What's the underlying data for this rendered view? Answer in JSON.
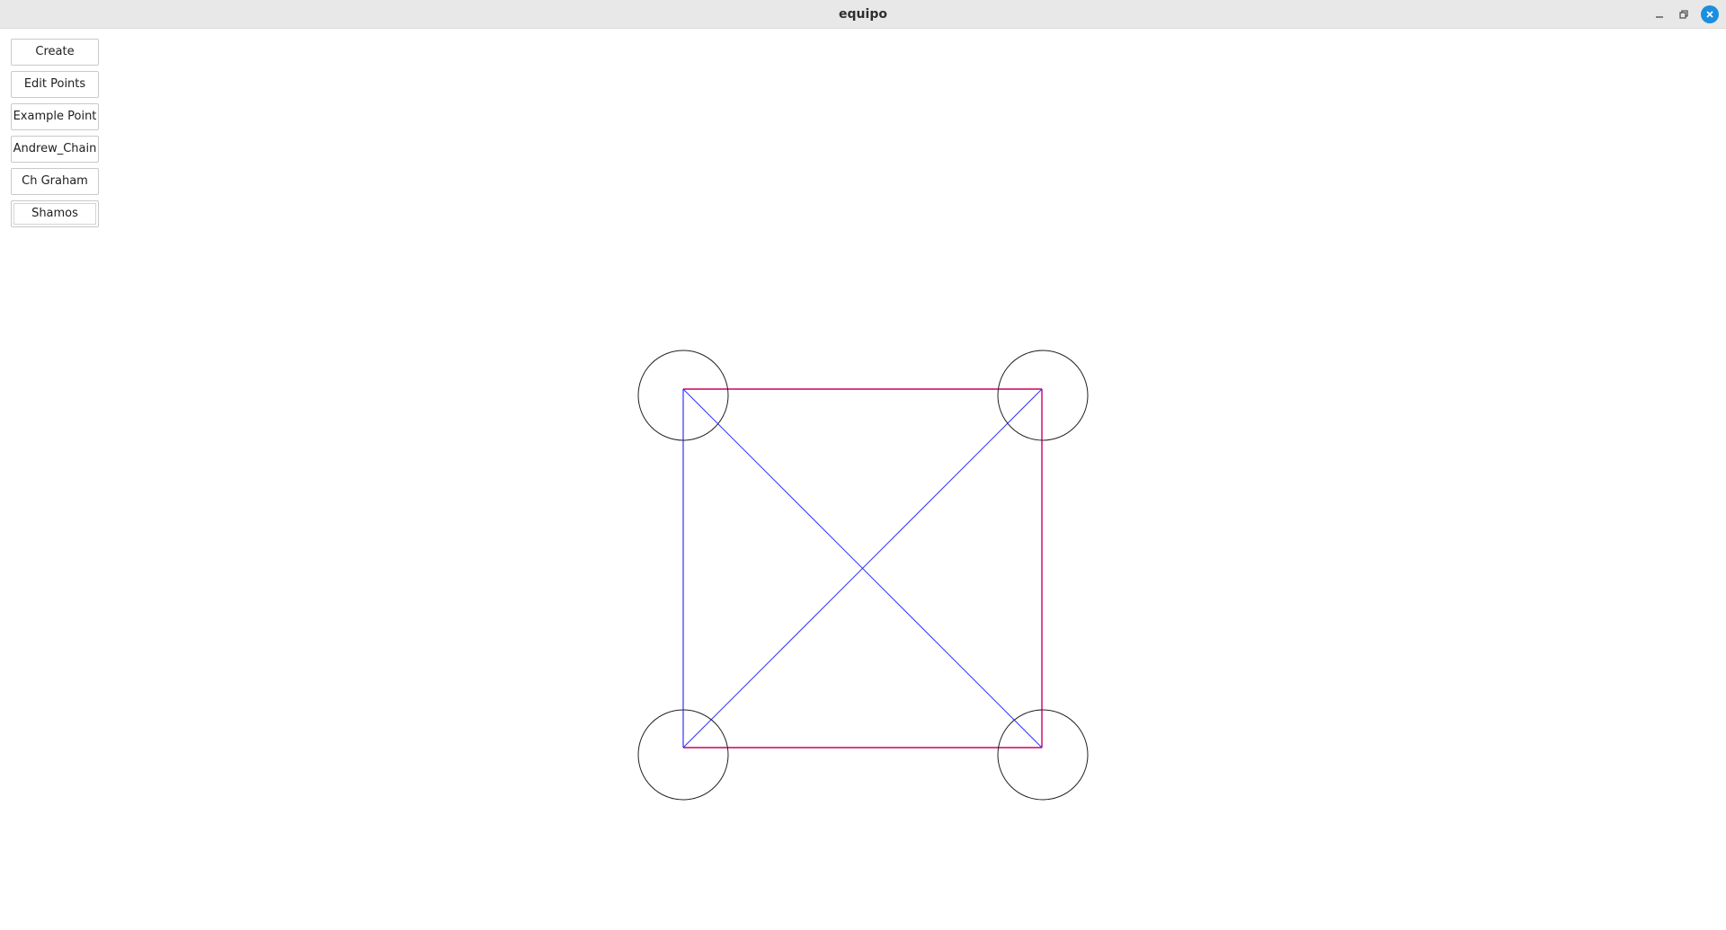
{
  "window": {
    "title": "equipo",
    "controls": {
      "minimize_icon": "minimize-icon",
      "maximize_icon": "maximize-icon",
      "close_icon": "close-icon"
    }
  },
  "toolbar": {
    "buttons": [
      {
        "label": "Create"
      },
      {
        "label": "Edit Points"
      },
      {
        "label": "Example Point"
      },
      {
        "label": "Andrew_Chain"
      },
      {
        "label": "Ch Graham"
      },
      {
        "label": "Shamos"
      }
    ]
  },
  "colors": {
    "hull_edges": "#cc0066",
    "diagonals": "#3333ff",
    "point_circles": "#222222",
    "close_button": "#1a8fe0"
  }
}
